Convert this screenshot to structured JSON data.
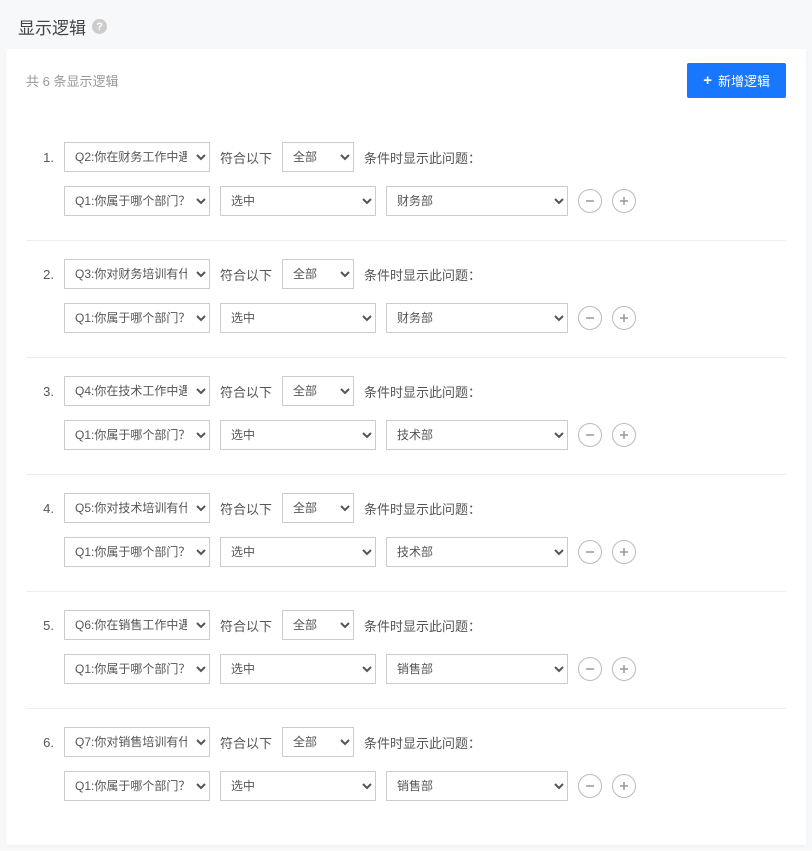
{
  "header": {
    "title": "显示逻辑",
    "help_icon": "?"
  },
  "panel": {
    "count_prefix": "共 ",
    "count_number": "6",
    "count_suffix": " 条显示逻辑",
    "add_button_label": "新增逻辑",
    "plus_symbol": "+"
  },
  "labels": {
    "meets_following": "符合以下",
    "conditions_show": "条件时显示此问题："
  },
  "rules": [
    {
      "index": "1.",
      "target_question": "Q2:你在财务工作中遇",
      "scope": "全部",
      "cond_question": "Q1:你属于哪个部门？",
      "operator": "选中",
      "value": "财务部"
    },
    {
      "index": "2.",
      "target_question": "Q3:你对财务培训有什",
      "scope": "全部",
      "cond_question": "Q1:你属于哪个部门？",
      "operator": "选中",
      "value": "财务部"
    },
    {
      "index": "3.",
      "target_question": "Q4:你在技术工作中遇",
      "scope": "全部",
      "cond_question": "Q1:你属于哪个部门？",
      "operator": "选中",
      "value": "技术部"
    },
    {
      "index": "4.",
      "target_question": "Q5:你对技术培训有什",
      "scope": "全部",
      "cond_question": "Q1:你属于哪个部门？",
      "operator": "选中",
      "value": "技术部"
    },
    {
      "index": "5.",
      "target_question": "Q6:你在销售工作中遇",
      "scope": "全部",
      "cond_question": "Q1:你属于哪个部门？",
      "operator": "选中",
      "value": "销售部"
    },
    {
      "index": "6.",
      "target_question": "Q7:你对销售培训有什",
      "scope": "全部",
      "cond_question": "Q1:你属于哪个部门？",
      "operator": "选中",
      "value": "销售部"
    }
  ]
}
